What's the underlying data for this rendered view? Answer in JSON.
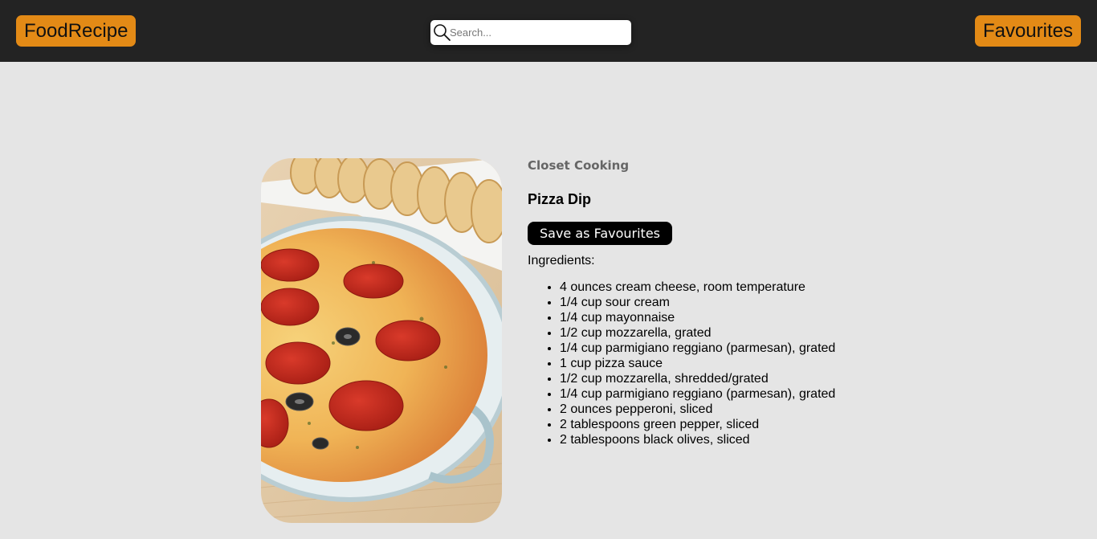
{
  "navbar": {
    "brand_label": "FoodRecipe",
    "favourites_label": "Favourites",
    "search_placeholder": "Search...",
    "search_value": "",
    "search_icon": "magnifier-icon",
    "accent_color": "#e38a16",
    "background_color": "#232323"
  },
  "recipe": {
    "image_alt": "Pizza Dip",
    "publisher": "Closet Cooking",
    "title": "Pizza Dip",
    "save_label": "Save as Favourites",
    "ingredients_label": "Ingredients:",
    "ingredients": [
      "4 ounces cream cheese, room temperature",
      "1/4 cup sour cream",
      "1/4 cup mayonnaise",
      "1/2 cup mozzarella, grated",
      "1/4 cup parmigiano reggiano (parmesan), grated",
      "1 cup pizza sauce",
      "1/2 cup mozzarella, shredded/grated",
      "1/4 cup parmigiano reggiano (parmesan), grated",
      "2 ounces pepperoni, sliced",
      "2 tablespoons green pepper, sliced",
      "2 tablespoons black olives, sliced"
    ]
  }
}
